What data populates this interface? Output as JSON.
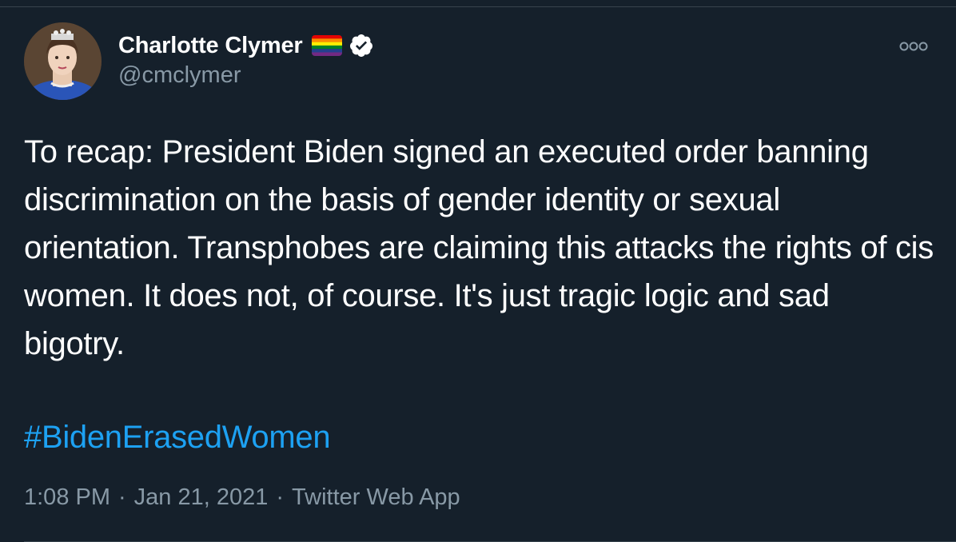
{
  "author": {
    "display_name": "Charlotte Clymer",
    "handle": "@cmclymer",
    "flag_icon": "rainbow-flag-icon",
    "verified_icon": "verified-badge-icon"
  },
  "tweet": {
    "text": "To recap: President Biden signed an executed order banning discrimination on the basis of gender identity or sexual orientation. Transphobes are claiming this attacks the rights of cis women. It does not, of course. It's just tragic logic and sad bigotry.",
    "hashtag": "#BidenErasedWomen"
  },
  "meta": {
    "time": "1:08 PM",
    "separator": "·",
    "date": "Jan 21, 2021",
    "source": "Twitter Web App"
  },
  "colors": {
    "background": "#15202b",
    "text": "#ffffff",
    "secondary_text": "#8899a6",
    "link": "#1da1f2",
    "border": "#38444d"
  }
}
